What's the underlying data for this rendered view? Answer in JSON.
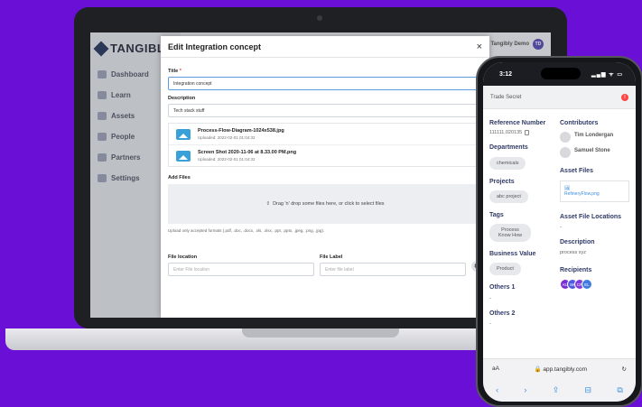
{
  "laptop": {
    "brand": "TANGIBLY",
    "user_name": "Tangibly Demo",
    "user_initials": "TD",
    "nav": [
      "Dashboard",
      "Learn",
      "Assets",
      "People",
      "Partners",
      "Settings"
    ]
  },
  "modal": {
    "title": "Edit Integration concept",
    "close": "×",
    "title_label": "Title",
    "title_required": "*",
    "title_value": "Integration concept",
    "description_label": "Description",
    "description_value": "Tech stack stuff",
    "files": [
      {
        "name": "Process-Flow-Diagram-1024x538.jpg",
        "uploaded": "Uploaded: 2022-02-01 01:04:32"
      },
      {
        "name": "Screen Shot 2020-11-06 at 8.33.00 PM.png",
        "uploaded": "Uploaded: 2022-02-01 01:04:32"
      }
    ],
    "add_files_label": "Add Files",
    "dropzone_text": "Drag 'n' drop some files here, or click to select files",
    "hint": "Upload only accepted formats (.pdf, .doc, .docx, .xls, .xlsx, .ppt, .pptx, .jpeg, .png, .jpg).",
    "file_location_label": "File location",
    "file_location_placeholder": "Enter File location",
    "file_label_label": "File Label",
    "file_label_placeholder": "Enter file label"
  },
  "phone": {
    "time": "3:12",
    "status_icons": "▂▄▆ ᯤ ▭",
    "header": "Trade Secret",
    "alert": "!",
    "left": [
      {
        "title": "Reference Number",
        "type": "ref",
        "value": "111111,020135"
      },
      {
        "title": "Departments",
        "type": "chips",
        "chips": [
          "chemicals"
        ]
      },
      {
        "title": "Projects",
        "type": "chips",
        "chips": [
          "abc project"
        ]
      },
      {
        "title": "Tags",
        "type": "chips",
        "chips": [
          "Process Know How"
        ]
      },
      {
        "title": "Business Value",
        "type": "chips",
        "chips": [
          "Product"
        ]
      },
      {
        "title": "Others 1",
        "type": "dash",
        "value": "-"
      },
      {
        "title": "Others 2",
        "type": "dash",
        "value": "-"
      }
    ],
    "contributors_title": "Contributors",
    "contributors": [
      "Tim Londergan",
      "Samuel Stone"
    ],
    "asset_files_title": "Asset Files",
    "asset_file": "RefineryFlow.png",
    "asset_locations_title": "Asset File Locations",
    "asset_locations_value": "-",
    "description_title": "Description",
    "description_value": "process xyz",
    "recipients_title": "Recipients",
    "recipients": [
      {
        "initials": "KL",
        "color": "#7a2fd6"
      },
      {
        "initials": "SK",
        "color": "#4f5be0"
      },
      {
        "initials": "CR",
        "color": "#7f3ad8"
      },
      {
        "initials": "EL",
        "color": "#3f7be0"
      }
    ],
    "url_aa": "aA",
    "url": "🔒 app.tangibly.com",
    "reload": "↻",
    "toolbar": [
      "‹",
      "›",
      "⇪",
      "⊟",
      "⧉"
    ]
  }
}
